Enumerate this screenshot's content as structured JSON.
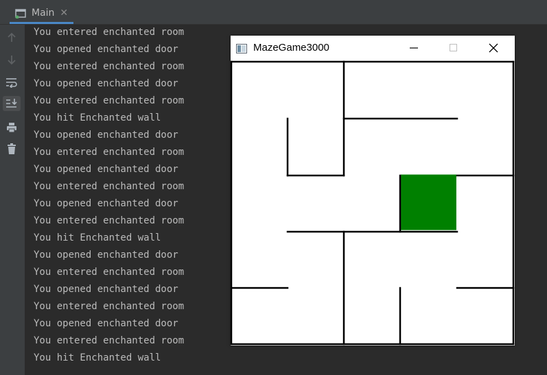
{
  "tab": {
    "label": "Main"
  },
  "toolbar": {
    "icons": [
      "arrow-up-icon",
      "arrow-down-icon",
      "soft-wrap-icon",
      "scroll-to-end-icon",
      "print-icon",
      "trash-icon"
    ]
  },
  "console": {
    "lines": [
      "You entered enchanted room",
      "You opened enchanted door",
      "You entered enchanted room",
      "You opened enchanted door",
      "You entered enchanted room",
      "You hit Enchanted wall",
      "You opened enchanted door",
      "You entered enchanted room",
      "You opened enchanted door",
      "You entered enchanted room",
      "You opened enchanted door",
      "You entered enchanted room",
      "You hit Enchanted wall",
      "You opened enchanted door",
      "You entered enchanted room",
      "You opened enchanted door",
      "You entered enchanted room",
      "You opened enchanted door",
      "You entered enchanted room",
      "You hit Enchanted wall"
    ]
  },
  "game_window": {
    "title": "MazeGame3000",
    "player_color": "#008000",
    "player_cell": {
      "col": 3,
      "row": 2
    },
    "grid": {
      "cols": 5,
      "rows": 5
    }
  },
  "colors": {
    "accent": "#4a88c7",
    "console_text": "#bbbbbb",
    "console_bg": "#2b2b2b"
  }
}
